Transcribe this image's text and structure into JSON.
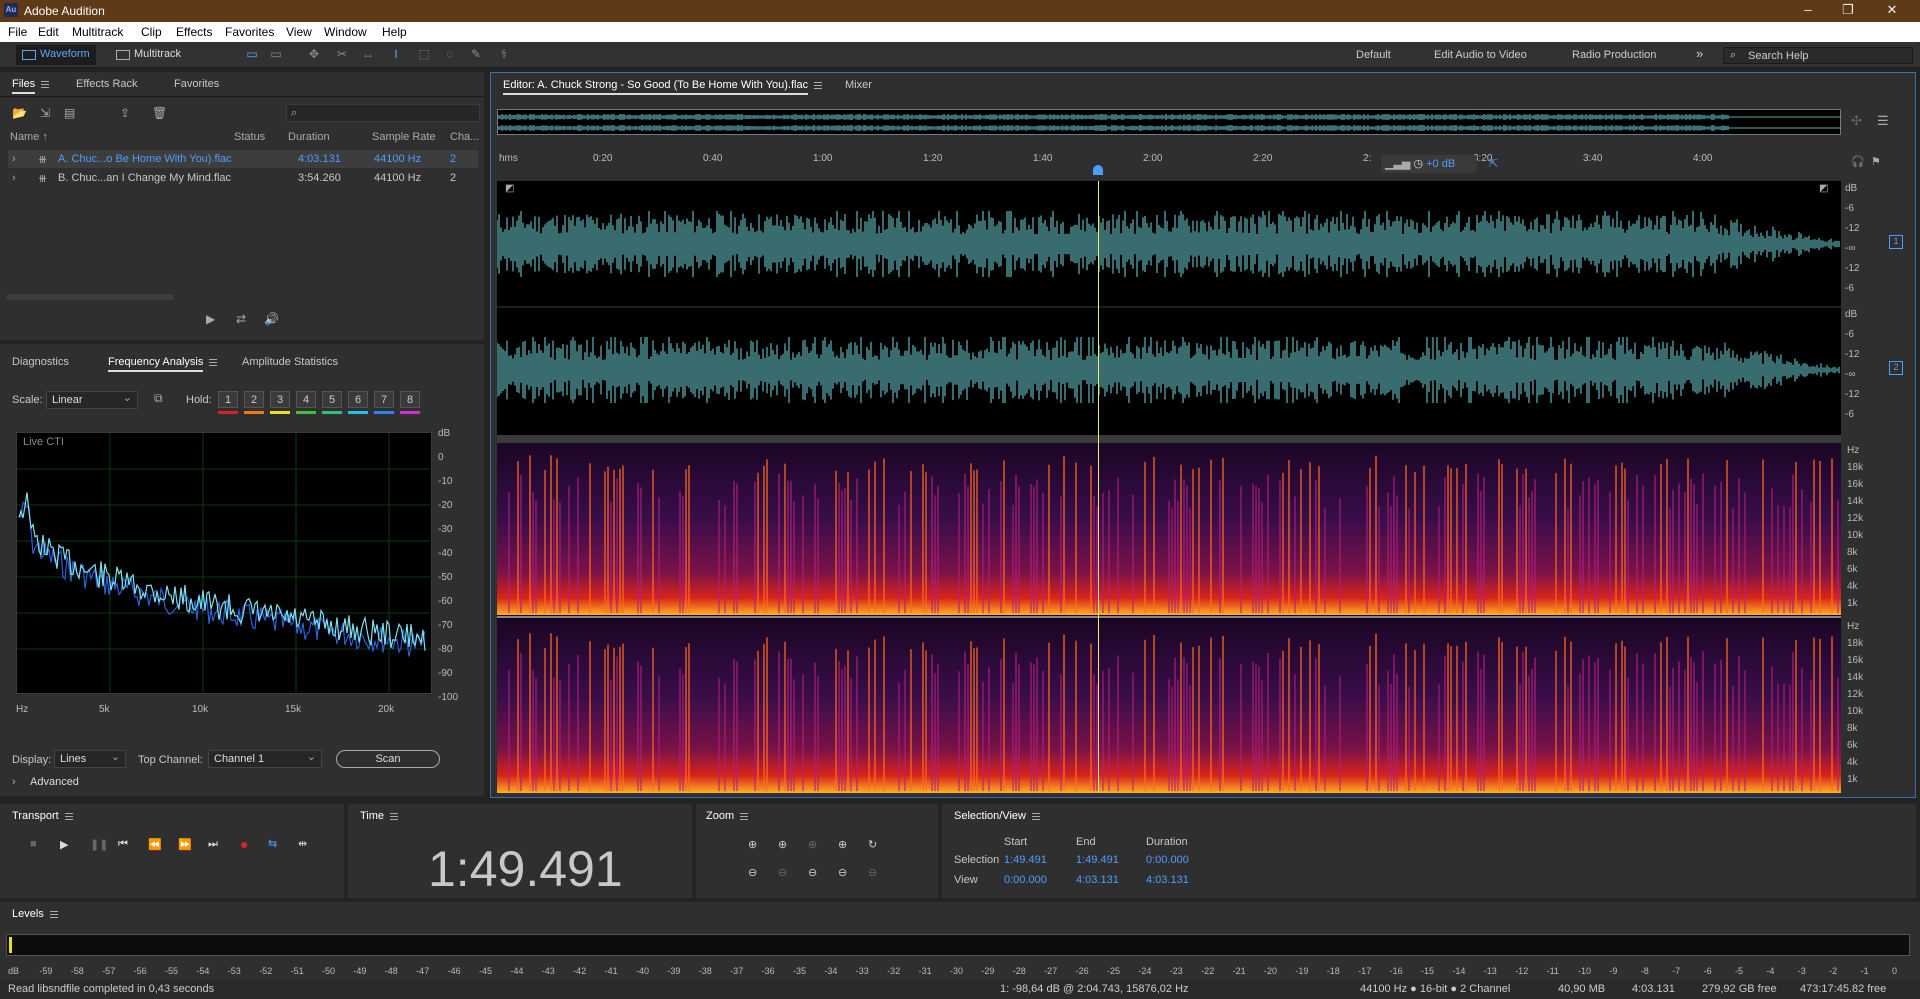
{
  "app": {
    "title": "Adobe Audition",
    "logo": "Au"
  },
  "menu": [
    "File",
    "Edit",
    "Multitrack",
    "Clip",
    "Effects",
    "Favorites",
    "View",
    "Window",
    "Help"
  ],
  "toolbar": {
    "waveform": "Waveform",
    "multitrack": "Multitrack",
    "workspaces": [
      "Default",
      "Edit Audio to Video",
      "Radio Production"
    ],
    "more": "»",
    "search_placeholder": "Search Help"
  },
  "files_panel": {
    "tabs": [
      "Files",
      "Effects Rack",
      "Favorites"
    ],
    "columns": [
      "Name ↑",
      "Status",
      "Duration",
      "Sample Rate",
      "Cha..."
    ],
    "rows": [
      {
        "name": "A. Chuc...o Be Home With You).flac",
        "duration": "4:03.131",
        "rate": "44100 Hz",
        "ch": "2"
      },
      {
        "name": "B. Chuc...an I Change My Mind.flac",
        "duration": "3:54.260",
        "rate": "44100 Hz",
        "ch": "2"
      }
    ]
  },
  "freq_panel": {
    "tabs": [
      "Diagnostics",
      "Frequency Analysis",
      "Amplitude Statistics"
    ],
    "scale_label": "Scale:",
    "scale_value": "Linear",
    "hold_label": "Hold:",
    "holds": [
      "1",
      "2",
      "3",
      "4",
      "5",
      "6",
      "7",
      "8"
    ],
    "hold_colors": [
      "#e02020",
      "#f07a10",
      "#e8e020",
      "#40c040",
      "#30c080",
      "#20c0e0",
      "#3080f0",
      "#d030d0"
    ],
    "graph_label": "Live CTI",
    "db_ticks": [
      "dB",
      "0",
      "-10",
      "-20",
      "-30",
      "-40",
      "-50",
      "-60",
      "-70",
      "-80",
      "-90",
      "-100"
    ],
    "hz_ticks": [
      "Hz",
      "5k",
      "10k",
      "15k",
      "20k"
    ],
    "display_label": "Display:",
    "display_value": "Lines",
    "top_channel_label": "Top Channel:",
    "top_channel_value": "Channel 1",
    "scan": "Scan",
    "advanced": "Advanced"
  },
  "editor": {
    "title": "Editor: A. Chuck Strong - So Good (To Be Home With You).flac",
    "mixer": "Mixer",
    "hud_gain": "+0 dB",
    "time_ticks": [
      "hms",
      "0:20",
      "0:40",
      "1:00",
      "1:20",
      "1:40",
      "2:00",
      "2:20",
      "2:",
      "3:20",
      "3:40",
      "4:00"
    ],
    "db_ticks": [
      "dB",
      "-6",
      "-12",
      "-∞",
      "-12",
      "-6"
    ],
    "channels": [
      "1",
      "2"
    ],
    "hz_ticks": [
      "Hz",
      "18k",
      "16k",
      "14k",
      "12k",
      "10k",
      "8k",
      "6k",
      "4k",
      "1k"
    ]
  },
  "transport": {
    "title": "Transport"
  },
  "time": {
    "title": "Time",
    "value": "1:49.491"
  },
  "zoom": {
    "title": "Zoom"
  },
  "selection": {
    "title": "Selection/View",
    "headers": [
      "Start",
      "End",
      "Duration"
    ],
    "selection_label": "Selection",
    "view_label": "View",
    "selection": [
      "1:49.491",
      "1:49.491",
      "0:00.000"
    ],
    "view": [
      "0:00.000",
      "4:03.131",
      "4:03.131"
    ]
  },
  "levels": {
    "title": "Levels",
    "ticks": [
      "dB",
      "-59",
      "-58",
      "-57",
      "-56",
      "-55",
      "-54",
      "-53",
      "-52",
      "-51",
      "-50",
      "-49",
      "-48",
      "-47",
      "-46",
      "-45",
      "-44",
      "-43",
      "-42",
      "-41",
      "-40",
      "-39",
      "-38",
      "-37",
      "-36",
      "-35",
      "-34",
      "-33",
      "-32",
      "-31",
      "-30",
      "-29",
      "-28",
      "-27",
      "-26",
      "-25",
      "-24",
      "-23",
      "-22",
      "-21",
      "-20",
      "-19",
      "-18",
      "-17",
      "-16",
      "-15",
      "-14",
      "-13",
      "-12",
      "-11",
      "-10",
      "-9",
      "-8",
      "-7",
      "-6",
      "-5",
      "-4",
      "-3",
      "-2",
      "-1",
      "0"
    ]
  },
  "statusbar": {
    "message": "Read libsndfile completed in 0,43 seconds",
    "cursor": "1: -98,64 dB @ 2:04.743, 15876,02 Hz",
    "format": "44100 Hz ● 16-bit ● 2 Channel",
    "size": "40,90 MB",
    "duration": "4:03.131",
    "free": "279,92 GB free",
    "free_time": "473:17:45.82 free"
  }
}
